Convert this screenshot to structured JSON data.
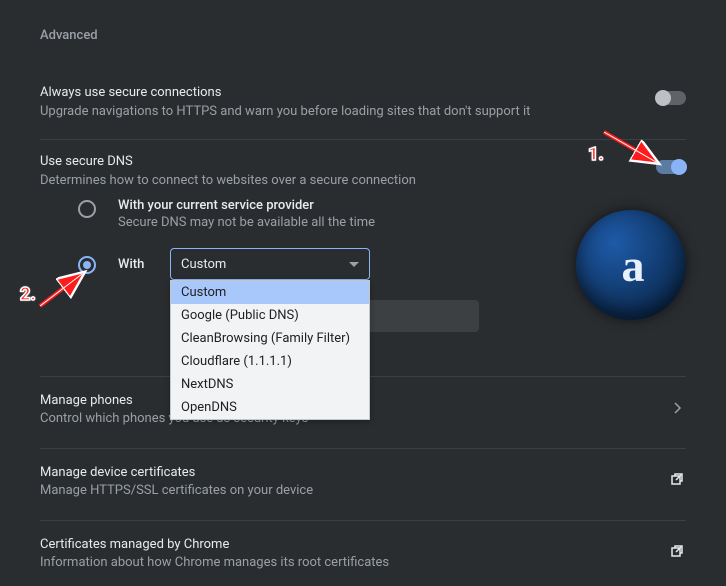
{
  "heading": "Advanced",
  "always_secure": {
    "title": "Always use secure connections",
    "desc": "Upgrade navigations to HTTPS and warn you before loading sites that don't support it",
    "enabled": false
  },
  "secure_dns": {
    "title": "Use secure DNS",
    "desc": "Determines how to connect to websites over a secure connection",
    "enabled": true,
    "option_current": {
      "title": "With your current service provider",
      "desc": "Secure DNS may not be available all the time",
      "selected": false
    },
    "option_with": {
      "label": "With",
      "selected": true,
      "select_value": "Custom",
      "options": [
        "Custom",
        "Google (Public DNS)",
        "CleanBrowsing (Family Filter)",
        "Cloudflare (1.1.1.1)",
        "NextDNS",
        "OpenDNS"
      ]
    }
  },
  "manage_phones": {
    "title": "Manage phones",
    "desc": "Control which phones you use as security keys"
  },
  "manage_certs": {
    "title": "Manage device certificates",
    "desc": "Manage HTTPS/SSL certificates on your device"
  },
  "chrome_certs": {
    "title": "Certificates managed by Chrome",
    "desc": "Information about how Chrome manages its root certificates"
  },
  "annotations": {
    "label1": "1.",
    "label2": "2."
  }
}
